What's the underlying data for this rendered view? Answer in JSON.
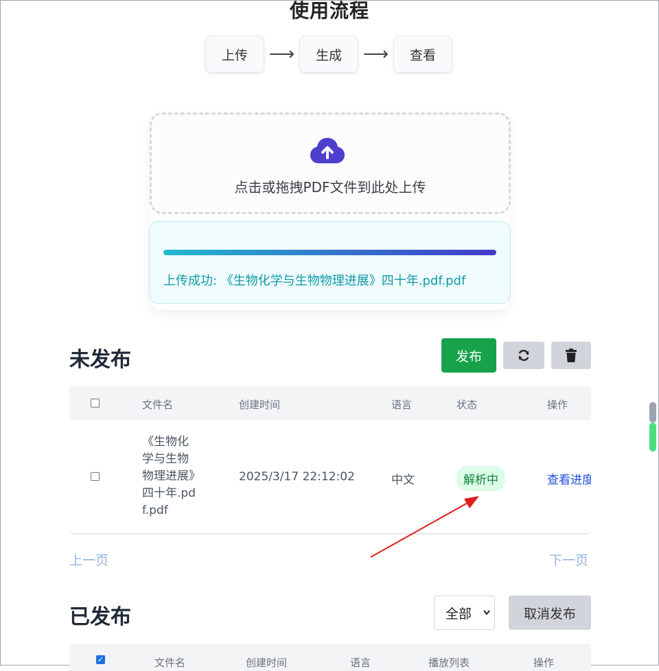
{
  "header": {
    "title": "使用流程"
  },
  "steps": [
    "上传",
    "生成",
    "查看"
  ],
  "step_arrow": "⟶",
  "upload": {
    "drop_text": "点击或拖拽PDF文件到此处上传",
    "progress": 1.0,
    "status_text": "上传成功: 《生物化学与生物物理进展》四十年.pdf.pdf"
  },
  "unpublished": {
    "title": "未发布",
    "publish_label": "发布",
    "columns": [
      "文件名",
      "创建时间",
      "语言",
      "状态",
      "操作"
    ],
    "rows": [
      {
        "filename": "《生物化学与生物物理进展》四十年.pdf.pdf",
        "created": "2025/3/17 22:12:02",
        "language": "中文",
        "status": "解析中",
        "action": "查看进度"
      }
    ],
    "prev": "上一页",
    "next": "下一页"
  },
  "published": {
    "title": "已发布",
    "filter": "全部",
    "unpublish_label": "取消发布",
    "columns": [
      "文件名",
      "创建时间",
      "语言",
      "播放列表",
      "操作"
    ]
  },
  "colors": {
    "primary": "#16a34a",
    "accent": "#4338ca",
    "status_ok": "#0e9aa7",
    "annotation": "#e11d1d"
  }
}
